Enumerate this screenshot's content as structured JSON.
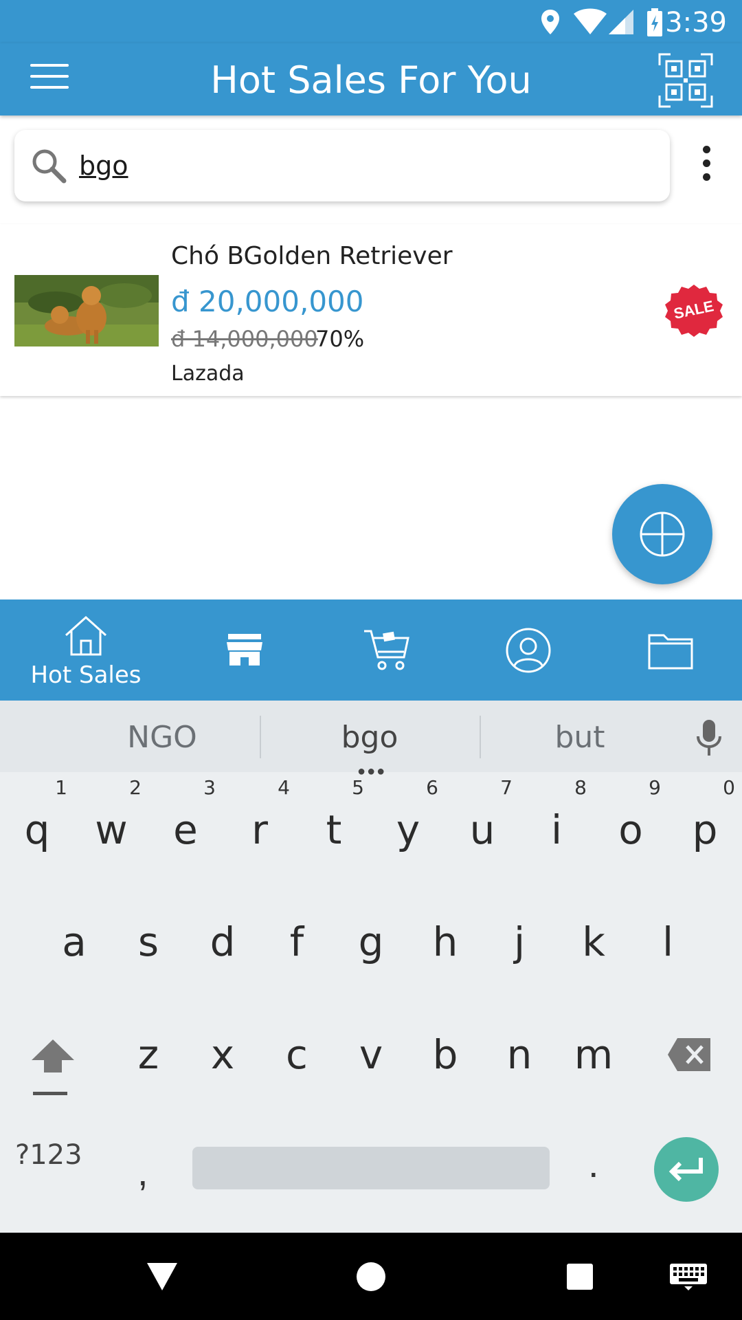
{
  "status_bar": {
    "time": "3:39"
  },
  "app_bar": {
    "title": "Hot Sales For You"
  },
  "search": {
    "value": "bgo",
    "placeholder": ""
  },
  "product": {
    "name": "Chó BGolden Retriever",
    "price": "đ 20,000,000",
    "old_price": "đ 14,000,000",
    "discount": "70%",
    "store": "Lazada",
    "badge": "SALE"
  },
  "bottom_nav": {
    "items": [
      {
        "label": "Hot Sales",
        "icon": "home-icon"
      },
      {
        "label": "",
        "icon": "store-icon"
      },
      {
        "label": "",
        "icon": "cart-icon"
      },
      {
        "label": "",
        "icon": "account-icon"
      },
      {
        "label": "",
        "icon": "folder-icon"
      }
    ]
  },
  "keyboard": {
    "suggestions": [
      "NGO",
      "bgo",
      "but"
    ],
    "row1": [
      "q",
      "w",
      "e",
      "r",
      "t",
      "y",
      "u",
      "i",
      "o",
      "p"
    ],
    "row1_hints": [
      "1",
      "2",
      "3",
      "4",
      "5",
      "6",
      "7",
      "8",
      "9",
      "0"
    ],
    "row2": [
      "a",
      "s",
      "d",
      "f",
      "g",
      "h",
      "j",
      "k",
      "l"
    ],
    "row3": [
      "z",
      "x",
      "c",
      "v",
      "b",
      "n",
      "m"
    ],
    "symbols_label": "?123",
    "comma": ",",
    "period": "."
  },
  "colors": {
    "primary": "#3796cf",
    "sale_red": "#e0283e",
    "enter_green": "#4fb6a3"
  }
}
